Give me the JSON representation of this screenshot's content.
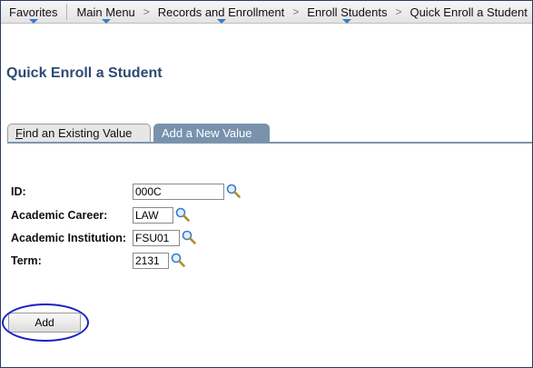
{
  "breadcrumb": {
    "favorites": "Favorites",
    "items": [
      "Main Menu",
      "Records and Enrollment",
      "Enroll Students",
      "Quick Enroll a Student"
    ],
    "separator": ">"
  },
  "page": {
    "title": "Quick Enroll a Student"
  },
  "tabs": {
    "find_first_letter": "F",
    "find_rest": "ind an Existing Value",
    "add_new": "Add a New Value"
  },
  "form": {
    "id_label": "ID:",
    "id_value": "000C",
    "career_label": "Academic Career:",
    "career_value": "LAW",
    "institution_label": "Academic Institution:",
    "institution_value": "FSU01",
    "term_label": "Term:",
    "term_value": "2131"
  },
  "buttons": {
    "add": "Add"
  },
  "colors": {
    "title": "#2d4a72",
    "active_tab": "#7892ad",
    "highlight_circle": "#1a22c4",
    "dropdown_arrow": "#3a7bc8"
  },
  "icons": {
    "lookup": "magnifier-icon"
  }
}
